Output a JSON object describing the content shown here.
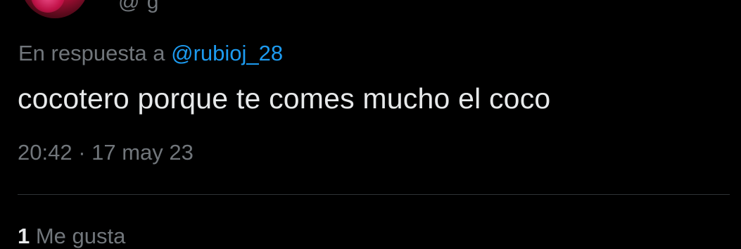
{
  "author": {
    "handle_partial": "@ g"
  },
  "reply": {
    "prefix": "En respuesta a ",
    "mention": "@rubioj_28"
  },
  "tweet": {
    "text": "cocotero porque te comes mucho el coco"
  },
  "meta": {
    "time": "20:42",
    "separator": " · ",
    "date": "17 may 23"
  },
  "stats": {
    "likes_count": "1",
    "likes_label": " Me gusta"
  },
  "colors": {
    "background": "#000000",
    "text_primary": "#e7e9ea",
    "text_secondary": "#71767b",
    "link": "#1d9bf0",
    "divider": "#2f3336"
  }
}
